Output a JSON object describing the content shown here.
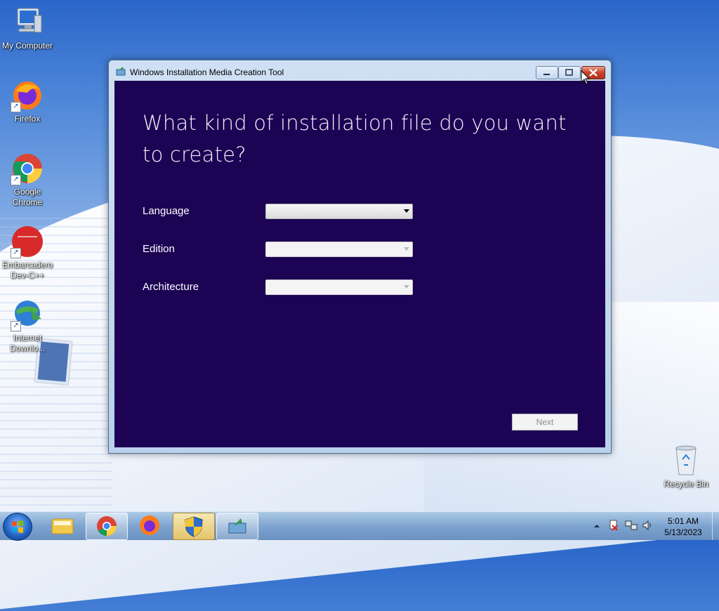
{
  "desktop": {
    "icons": [
      {
        "label": "My Computer"
      },
      {
        "label": "Firefox"
      },
      {
        "label": "Google Chrome"
      },
      {
        "label": "Embarcadero Dev-C++"
      },
      {
        "label": "Internet Downlo..."
      }
    ],
    "recycle_bin_label": "Recycle Bin"
  },
  "window": {
    "title": "Windows Installation Media Creation Tool",
    "heading": "What kind of installation file do you want to create?",
    "fields": [
      {
        "label": "Language",
        "value": "",
        "enabled": true
      },
      {
        "label": "Edition",
        "value": "",
        "enabled": false
      },
      {
        "label": "Architecture",
        "value": "",
        "enabled": false
      }
    ],
    "next_label": "Next"
  },
  "taskbar": {
    "apps": [
      "windows-explorer",
      "google-chrome",
      "firefox",
      "uac-shield",
      "media-creation-tool"
    ],
    "time": "5:01 AM",
    "date": "5/13/2023"
  },
  "colors": {
    "window_background": "#1c0354",
    "close_button": "#c7432a"
  }
}
